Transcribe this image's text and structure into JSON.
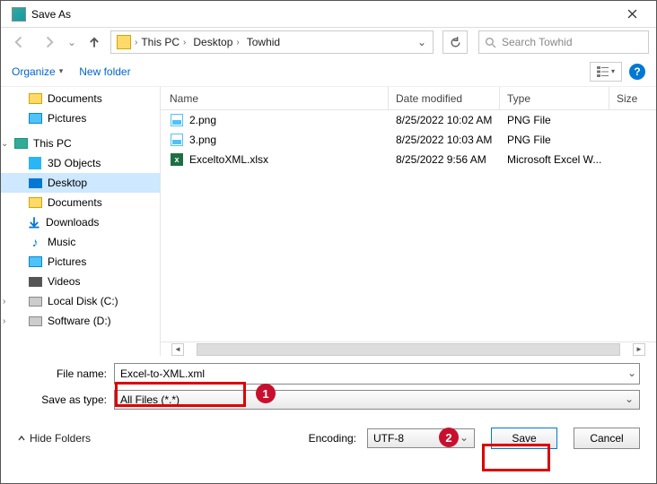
{
  "window": {
    "title": "Save As"
  },
  "breadcrumb": {
    "seg1": "This PC",
    "seg2": "Desktop",
    "seg3": "Towhid"
  },
  "search": {
    "placeholder": "Search Towhid"
  },
  "toolbar": {
    "organize": "Organize",
    "newfolder": "New folder"
  },
  "sidebar": {
    "documents": "Documents",
    "pictures": "Pictures",
    "thispc": "This PC",
    "objects3d": "3D Objects",
    "desktop": "Desktop",
    "documents2": "Documents",
    "downloads": "Downloads",
    "music": "Music",
    "pictures2": "Pictures",
    "videos": "Videos",
    "localdisk": "Local Disk (C:)",
    "software": "Software (D:)"
  },
  "columns": {
    "name": "Name",
    "date": "Date modified",
    "type": "Type",
    "size": "Size"
  },
  "files": {
    "f1": {
      "name": "2.png",
      "date": "8/25/2022 10:02 AM",
      "type": "PNG File"
    },
    "f2": {
      "name": "3.png",
      "date": "8/25/2022 10:03 AM",
      "type": "PNG File"
    },
    "f3": {
      "name": "ExceltoXML.xlsx",
      "date": "8/25/2022 9:56 AM",
      "type": "Microsoft Excel W..."
    }
  },
  "form": {
    "filename_label": "File name:",
    "filename_value": "Excel-to-XML.xml",
    "saveastype_label": "Save as type:",
    "saveastype_value": "All Files  (*.*)"
  },
  "bottom": {
    "hidefolders": "Hide Folders",
    "encoding_label": "Encoding:",
    "encoding_value": "UTF-8",
    "save": "Save",
    "cancel": "Cancel"
  },
  "annotations": {
    "badge1": "1",
    "badge2": "2"
  }
}
